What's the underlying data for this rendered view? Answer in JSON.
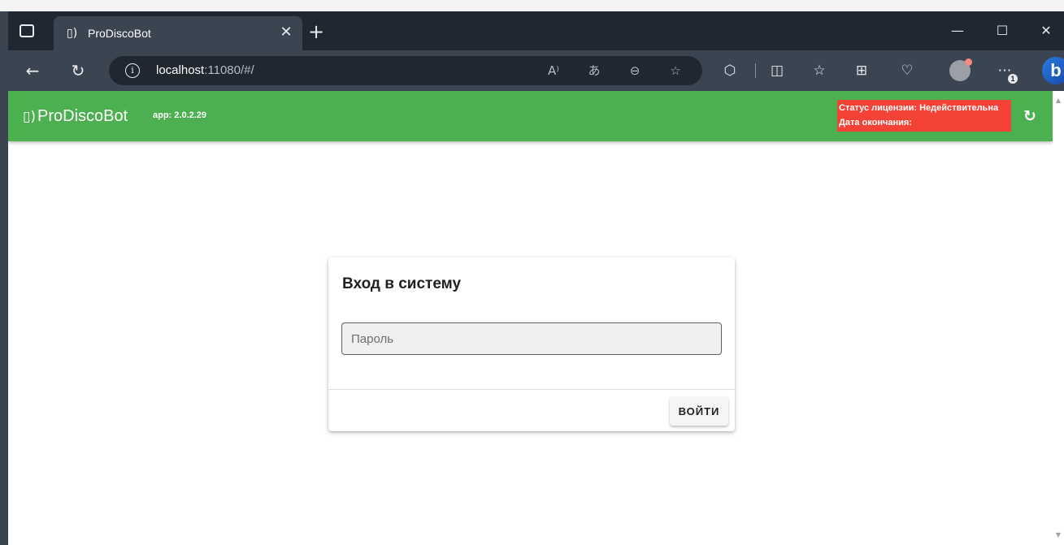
{
  "browser": {
    "tab": {
      "title": "ProDiscoBot",
      "favicon_icon": "chatbot-icon"
    },
    "new_tab_icon": "plus-icon",
    "url": {
      "host": "localhost",
      "rest": ":11080/#/"
    },
    "omnibox_icons": [
      "read-aloud-icon",
      "translate-icon",
      "zoom-out-icon",
      "favorite-star-icon"
    ],
    "toolbar_icons": [
      "extensions-icon",
      "split-screen-icon",
      "favorites-icon",
      "collections-icon",
      "browser-essentials-icon",
      "profile-icon",
      "more-icon",
      "bing-copilot-icon"
    ],
    "more_badge": "1"
  },
  "app": {
    "logo_text": "ProDiscoBot",
    "version": "app: 2.0.2.29",
    "license_status": "Статус лицензии: Недействительна",
    "license_end": "Дата окончания:",
    "status_color": "#f44336",
    "header_color": "#4caf50"
  },
  "login": {
    "title": "Вход в систему",
    "password_placeholder": "Пароль",
    "password_value": "",
    "submit_label": "ВОЙТИ"
  }
}
